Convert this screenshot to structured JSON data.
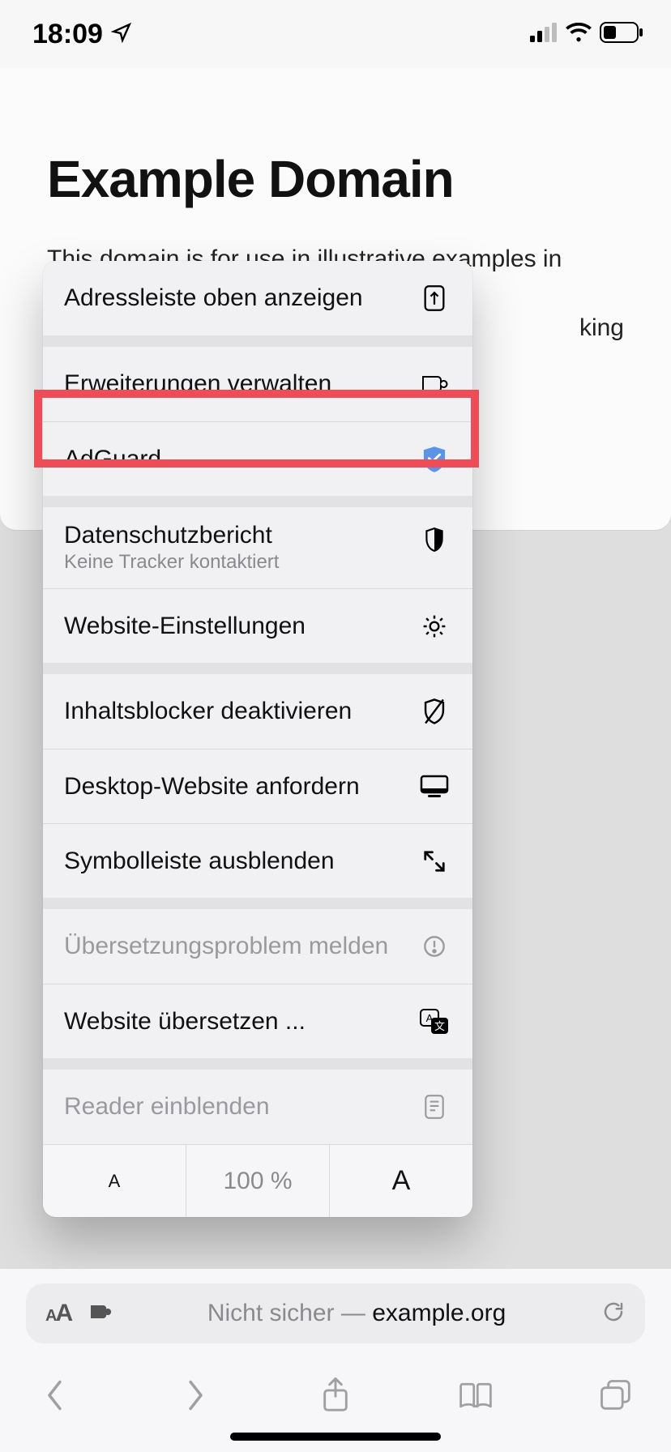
{
  "status": {
    "time": "18:09"
  },
  "page": {
    "title": "Example Domain",
    "para1": "This domain is for use in illustrative examples in",
    "para_tail": "king"
  },
  "menu": {
    "address_top": "Adressleiste oben anzeigen",
    "manage_ext": "Erweiterungen verwalten",
    "adguard": "AdGuard",
    "privacy_label": "Datenschutzbericht",
    "privacy_sub": "Keine Tracker kontaktiert",
    "site_settings": "Website-Einstellungen",
    "content_blockers": "Inhaltsblocker deaktivieren",
    "desktop_site": "Desktop-Website anfordern",
    "hide_toolbar": "Symbolleiste ausblenden",
    "report_translation": "Übersetzungsproblem melden",
    "translate": "Website übersetzen ...",
    "reader": "Reader einblenden",
    "zoom_small": "A",
    "zoom_pct": "100 %",
    "zoom_big": "A"
  },
  "url": {
    "prefix": "Nicht sicher — ",
    "domain": "example.org"
  }
}
